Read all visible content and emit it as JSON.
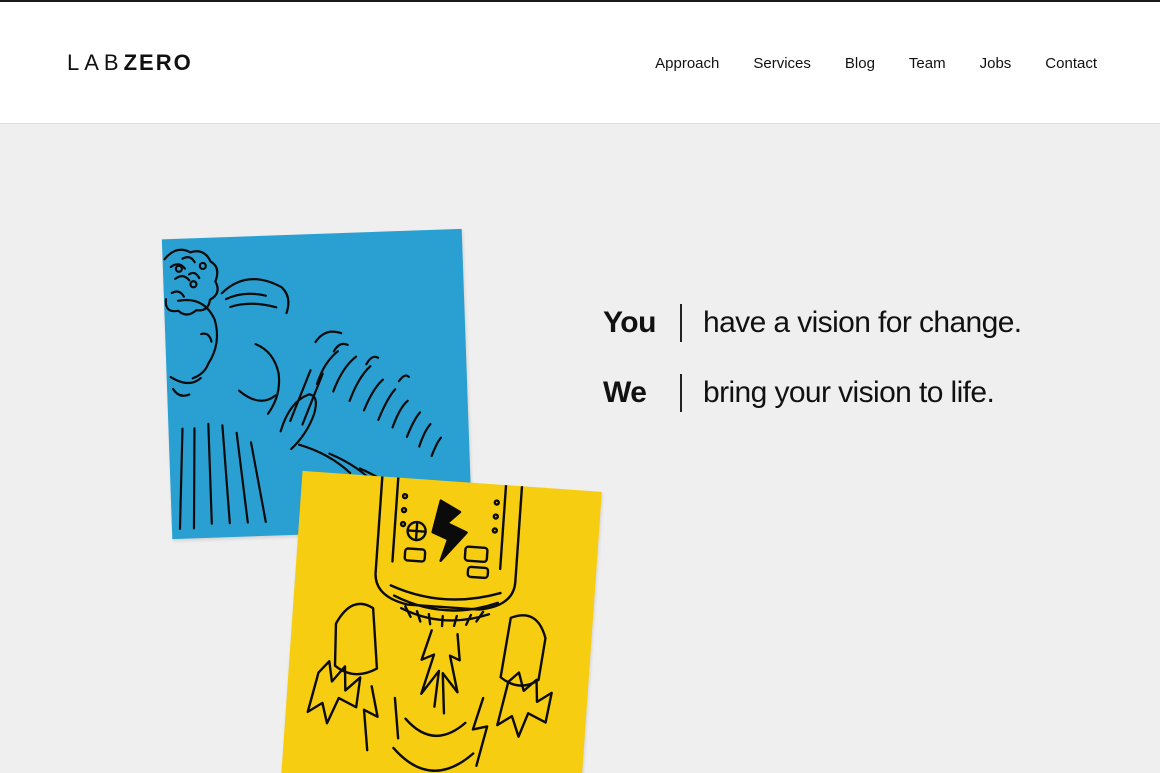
{
  "header": {
    "logo": {
      "part1": "LAB",
      "part2": "ZERO"
    },
    "nav": [
      "Approach",
      "Services",
      "Blog",
      "Team",
      "Jobs",
      "Contact"
    ]
  },
  "hero": {
    "lines": [
      {
        "who": "You",
        "text": "have a vision for change."
      },
      {
        "who": "We",
        "text": "bring your vision to life."
      }
    ],
    "notes": [
      {
        "color": "#2aa0d2",
        "illustration": "people-sketch-icon"
      },
      {
        "color": "#f7cd11",
        "illustration": "rocket-sketch-icon"
      }
    ]
  },
  "colors": {
    "background": "#efefef",
    "header": "#ffffff",
    "text": "#111111"
  }
}
